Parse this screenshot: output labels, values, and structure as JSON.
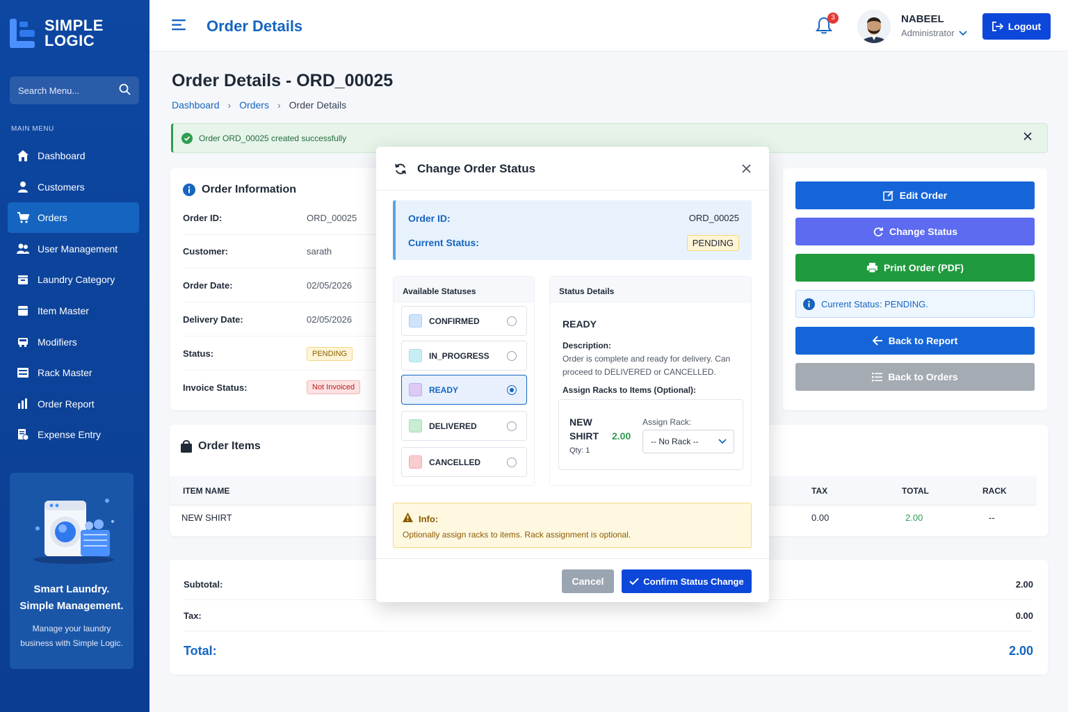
{
  "brand": {
    "name_line1": "SIMPLE",
    "name_line2": "LOGIC"
  },
  "sidebar": {
    "search_placeholder": "Search Menu...",
    "menu_label": "MAIN MENU",
    "items": [
      {
        "label": "Dashboard",
        "icon": "home-icon"
      },
      {
        "label": "Customers",
        "icon": "user-icon"
      },
      {
        "label": "Orders",
        "icon": "cart-icon",
        "active": true
      },
      {
        "label": "User Management",
        "icon": "users-icon"
      },
      {
        "label": "Laundry Category",
        "icon": "category-icon"
      },
      {
        "label": "Item Master",
        "icon": "box-icon"
      },
      {
        "label": "Modifiers",
        "icon": "layers-icon"
      },
      {
        "label": "Rack Master",
        "icon": "rack-icon"
      },
      {
        "label": "Order Report",
        "icon": "chart-icon"
      },
      {
        "label": "Expense Entry",
        "icon": "receipt-icon"
      }
    ],
    "promo": {
      "title_line1": "Smart Laundry.",
      "title_line2": "Simple Management.",
      "subtitle": "Manage your laundry business with Simple Logic."
    }
  },
  "topbar": {
    "title": "Order Details",
    "notifications": "3",
    "user_name": "NABEEL",
    "user_role": "Administrator",
    "logout": "Logout"
  },
  "page": {
    "title": "Order Details - ORD_00025",
    "breadcrumb": [
      "Dashboard",
      "Orders",
      "Order Details"
    ],
    "alert": "Order ORD_00025 created successfully"
  },
  "order_info": {
    "title": "Order Information",
    "rows": [
      {
        "label": "Order ID:",
        "value": "ORD_00025"
      },
      {
        "label": "Customer:",
        "value": "sarath"
      },
      {
        "label": "Order Date:",
        "value": "02/05/2026"
      },
      {
        "label": "Delivery Date:",
        "value": "02/05/2026"
      },
      {
        "label": "Status:",
        "value": "PENDING"
      },
      {
        "label": "Invoice Status:",
        "value": "Not Invoiced"
      }
    ]
  },
  "order_items": {
    "title": "Order Items",
    "columns": {
      "item_name": "ITEM NAME",
      "tax": "TAX",
      "total": "TOTAL",
      "rack": "RACK"
    },
    "rows": [
      {
        "item_name": "NEW SHIRT",
        "tax": "0.00",
        "total": "2.00",
        "rack": "--"
      }
    ]
  },
  "totals": {
    "subtotal_label": "Subtotal:",
    "subtotal": "2.00",
    "tax_label": "Tax:",
    "tax": "0.00",
    "total_label": "Total:",
    "total": "2.00"
  },
  "actions": {
    "edit": "Edit Order",
    "change_status": "Change Status",
    "print": "Print Order (PDF)",
    "current_status": "Current Status: PENDING.",
    "back_report": "Back to Report",
    "back_orders": "Back to Orders"
  },
  "modal": {
    "title": "Change Order Status",
    "order_id_label": "Order ID:",
    "order_id": "ORD_00025",
    "current_status_label": "Current Status:",
    "current_status": "PENDING",
    "available_title": "Available Statuses",
    "statuses": [
      {
        "label": "CONFIRMED",
        "color": "#cfe3fb"
      },
      {
        "label": "IN_PROGRESS",
        "color": "#c8eef5"
      },
      {
        "label": "READY",
        "color": "#dcc9f5",
        "selected": true
      },
      {
        "label": "DELIVERED",
        "color": "#c9ecd2"
      },
      {
        "label": "CANCELLED",
        "color": "#f9cdd0"
      }
    ],
    "details_title": "Status Details",
    "selected_status": "READY",
    "description_label": "Description:",
    "description": "Order is complete and ready for delivery. Can proceed to DELIVERED or CANCELLED.",
    "assign_label": "Assign Racks to Items (Optional):",
    "item": {
      "name": "NEW SHIRT",
      "price": "2.00",
      "qty": "Qty: 1",
      "assign_label": "Assign Rack:",
      "rack_value": "-- No Rack --"
    },
    "info_title": "Info:",
    "info_text": "Optionally assign racks to items. Rack assignment is optional.",
    "cancel": "Cancel",
    "confirm": "Confirm Status Change"
  },
  "colors": {
    "primary": "#1565c0",
    "sidebar": "#0d47a1",
    "success": "#2e9d4f",
    "purple": "#5c6bf0"
  }
}
